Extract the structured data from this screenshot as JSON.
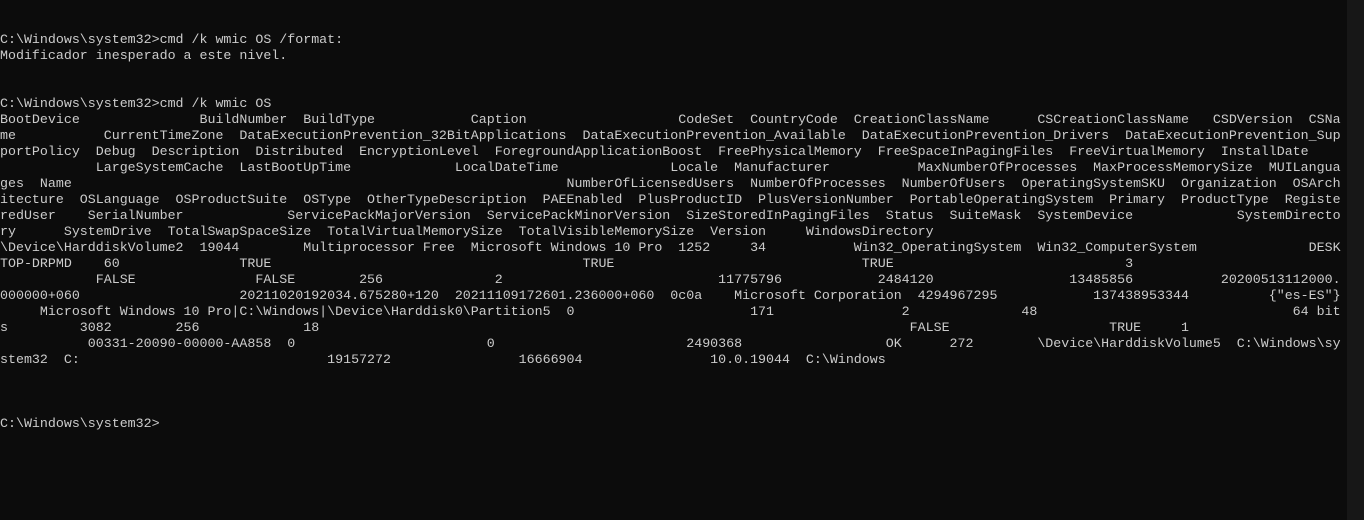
{
  "window": {
    "background": "#0c0c0c",
    "foreground": "#cccccc"
  },
  "terminal": {
    "lines": [
      "",
      "",
      "C:\\Windows\\system32>cmd /k wmic OS /format:",
      "Modificador inesperado a este nivel.",
      "",
      "",
      "C:\\Windows\\system32>cmd /k wmic OS",
      "BootDevice               BuildNumber  BuildType            Caption                   CodeSet  CountryCode  CreationClassName      CSCreationClassName   CSDVersion  CSNa",
      "me           CurrentTimeZone  DataExecutionPrevention_32BitApplications  DataExecutionPrevention_Available  DataExecutionPrevention_Drivers  DataExecutionPrevention_Sup",
      "portPolicy  Debug  Description  Distributed  EncryptionLevel  ForegroundApplicationBoost  FreePhysicalMemory  FreeSpaceInPagingFiles  FreeVirtualMemory  InstallDate",
      "            LargeSystemCache  LastBootUpTime             LocalDateTime              Locale  Manufacturer           MaxNumberOfProcesses  MaxProcessMemorySize  MUILangua",
      "ges  Name                                                              NumberOfLicensedUsers  NumberOfProcesses  NumberOfUsers  OperatingSystemSKU  Organization  OSArch",
      "itecture  OSLanguage  OSProductSuite  OSType  OtherTypeDescription  PAEEnabled  PlusProductID  PlusVersionNumber  PortableOperatingSystem  Primary  ProductType  Registe",
      "redUser    SerialNumber             ServicePackMajorVersion  ServicePackMinorVersion  SizeStoredInPagingFiles  Status  SuiteMask  SystemDevice             SystemDirecto",
      "ry      SystemDrive  TotalSwapSpaceSize  TotalVirtualMemorySize  TotalVisibleMemorySize  Version     WindowsDirectory",
      "\\Device\\HarddiskVolume2  19044        Multiprocessor Free  Microsoft Windows 10 Pro  1252     34           Win32_OperatingSystem  Win32_ComputerSystem              DESK",
      "TOP-DRPMD    60               TRUE                                       TRUE                               TRUE                             3",
      "            FALSE               FALSE        256              2                           11775796            2484120                 13485856           20200513112000.",
      "000000+060                    20211020192034.675280+120  20211109172601.236000+060  0c0a    Microsoft Corporation  4294967295            137438953344          {\"es-ES\"}",
      "     Microsoft Windows 10 Pro|C:\\Windows|\\Device\\Harddisk0\\Partition5  0                      171                2              48                                64 bit",
      "s         3082        256             18                                                                          FALSE                    TRUE     1",
      "           00331-20090-00000-AA858  0                        0                        2490368                  OK      272        \\Device\\HarddiskVolume5  C:\\Windows\\sy",
      "stem32  C:                               19157272                16666904                10.0.19044  C:\\Windows",
      "",
      "",
      "",
      "C:\\Windows\\system32>"
    ]
  }
}
